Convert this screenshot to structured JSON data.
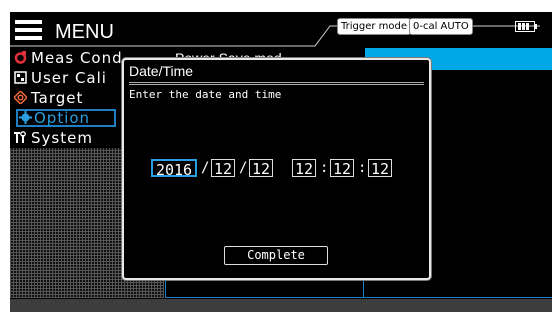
{
  "header": {
    "menu_title": "MENU",
    "trigger_label": "Trigger mode",
    "cal_label": "0-cal AUTO",
    "battery_icon": "battery-icon"
  },
  "sidebar": {
    "items": [
      {
        "label": "Meas Cond",
        "icon": "meas-icon",
        "selected": false
      },
      {
        "label": "User Cali",
        "icon": "user-cal-icon",
        "selected": false
      },
      {
        "label": "Target",
        "icon": "target-icon",
        "selected": false
      },
      {
        "label": "Option",
        "icon": "gear-icon",
        "selected": true
      },
      {
        "label": "System",
        "icon": "tools-icon",
        "selected": false
      }
    ]
  },
  "right_panel": {
    "title": "Power Save mod"
  },
  "dialog": {
    "title": "Date/Time",
    "prompt": "Enter the date and time",
    "year": "2016",
    "month": "12",
    "day": "12",
    "hour": "12",
    "minute": "12",
    "second": "12",
    "date_separator": "/",
    "time_separator": ":",
    "complete_label": "Complete"
  },
  "colors": {
    "accent": "#2a9fe0",
    "highlight_strip": "#00a8e8",
    "background": "#000000"
  }
}
